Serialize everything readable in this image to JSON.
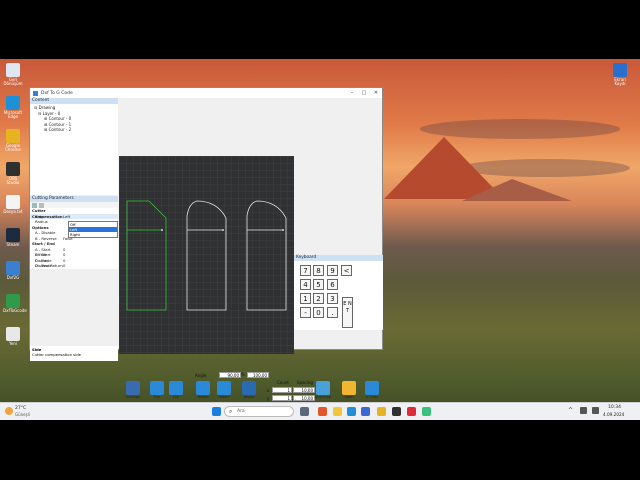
{
  "desktop": {
    "icons": [
      {
        "label": "Geri Dönüşüm",
        "color": "#dfe8f2"
      },
      {
        "label": "Microsoft Edge",
        "color": "#1f8fd6"
      },
      {
        "label": "Google Chrome",
        "color": "#e8b320"
      },
      {
        "label": "OBS Studio",
        "color": "#303030"
      },
      {
        "label": "Dosya.txt",
        "color": "#f4f4f4"
      },
      {
        "label": "Steam",
        "color": "#1e2a3e"
      },
      {
        "label": "Dxf2G",
        "color": "#3a7fd0"
      },
      {
        "label": "DxfToGcode",
        "color": "#2f9a4a"
      },
      {
        "label": "Yeni",
        "color": "#e8e8e8"
      }
    ],
    "right_icon": {
      "label": "Ekran Kaydı",
      "color": "#2a6fce"
    }
  },
  "window": {
    "title": "Dxf To G Code",
    "content_head": "Content",
    "tree": [
      "Drawing",
      "Layer - 0",
      "Contour - 0",
      "Contour - 1",
      "Contour - 2"
    ],
    "params_head": "Cutting Parameters",
    "params": [
      {
        "k": "Cutter Compensation",
        "v": "",
        "section": true
      },
      {
        "k": "Side",
        "v": "Left",
        "section": false,
        "selected": true
      },
      {
        "k": "Radius",
        "v": "",
        "section": false
      },
      {
        "k": "Options",
        "v": "",
        "section": true
      },
      {
        "k": "A - Disable",
        "v": "",
        "section": false
      },
      {
        "k": "B - Reverse",
        "v": "False",
        "section": false
      },
      {
        "k": "Start / End",
        "v": "",
        "section": true
      },
      {
        "k": "A - Start Offset",
        "v": "0",
        "section": false
      },
      {
        "k": "B - Start Distance",
        "v": "0",
        "section": false
      },
      {
        "k": "C - End Distance",
        "v": "0",
        "section": false
      },
      {
        "k": "D - End Return",
        "v": "0",
        "section": false
      }
    ],
    "dropdown": [
      "Off",
      "Left",
      "Right"
    ],
    "dropdown_selected": 1,
    "desc_title": "Side",
    "desc_text": "Cutter compensation side",
    "keyboard_head": "Keyboard",
    "keys": [
      "7",
      "8",
      "9",
      "<",
      "4",
      "5",
      "6",
      "1",
      "2",
      "3",
      "-",
      "0",
      "."
    ],
    "enter_key": "E N T"
  },
  "toolbar": {
    "angle_label": "Angle",
    "angle_value": "90,00",
    "percent": "%",
    "percent_value": "100,00",
    "count_label": "Count",
    "spacing_label": "Spacing",
    "x_label": "x",
    "y_label": "y",
    "x_count": "1",
    "x_spacing": "10,00",
    "y_count": "1",
    "y_spacing": "10,00",
    "buttons": [
      "Settings",
      "Flip",
      "Flip",
      "Rotate",
      "Rotate",
      "Resize",
      "Duplicate",
      "Open",
      "G Code"
    ]
  },
  "taskbar": {
    "weather": "27°C",
    "weather_sub": "Güneşli",
    "search_placeholder": "Ara",
    "time": "10:34",
    "date": "4.09.2024"
  },
  "colors": {
    "accent": "#2b73d8",
    "shape_selected": "#3ac23a",
    "shape_default": "#e6e6e6"
  }
}
